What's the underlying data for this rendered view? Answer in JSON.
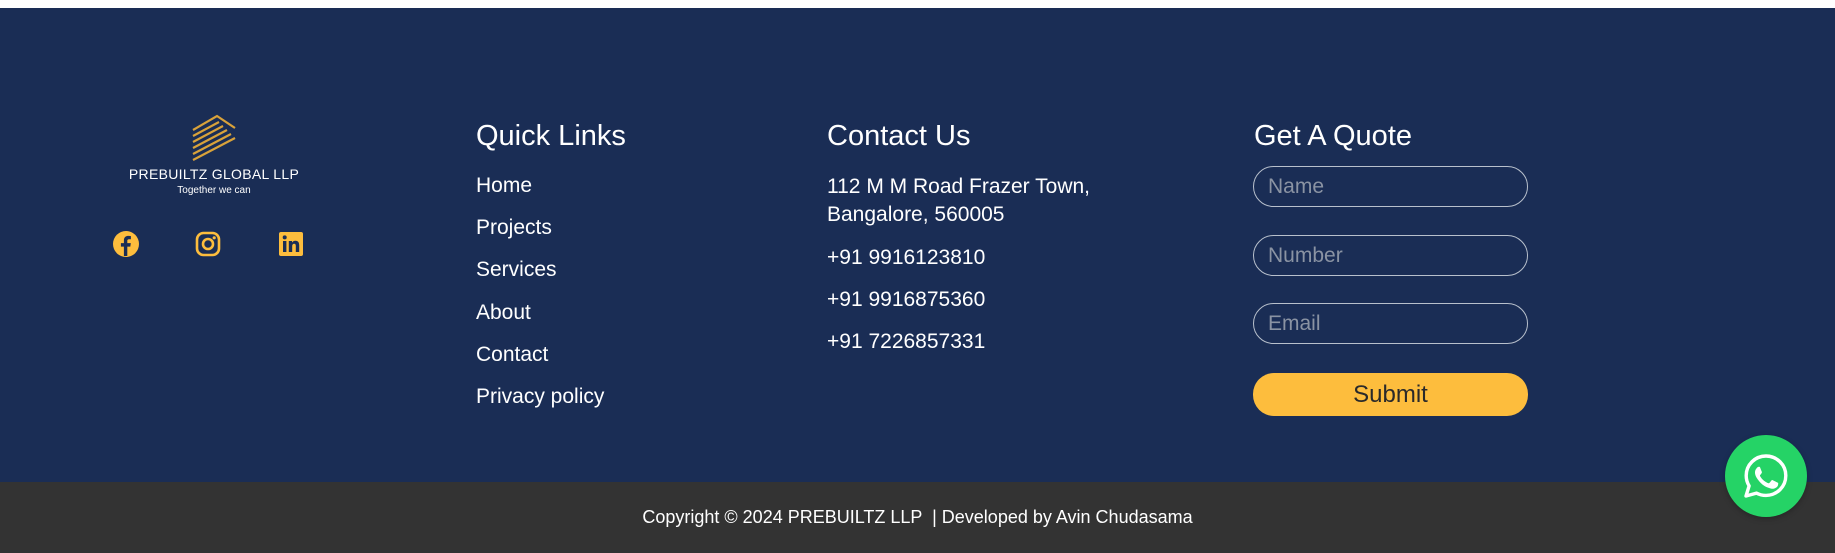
{
  "colors": {
    "footer_bg": "#1a2d55",
    "bottom_bar_bg": "#333333",
    "accent": "#fdbd3d",
    "whatsapp": "#25d366"
  },
  "brand": {
    "name": "PREBUILTZ GLOBAL LLP",
    "tagline": "Together we can",
    "social": [
      "facebook-icon",
      "instagram-icon",
      "linkedin-icon"
    ]
  },
  "quick_links": {
    "title": "Quick Links",
    "items": [
      "Home",
      "Projects",
      "Services",
      "About",
      "Contact",
      "Privacy policy"
    ]
  },
  "contact": {
    "title": "Contact Us",
    "address_line1": "112 M M Road Frazer Town,",
    "address_line2": "Bangalore, 560005",
    "phones": [
      "+91 9916123810",
      "+91 9916875360",
      "+91 7226857331"
    ]
  },
  "quote": {
    "title": "Get A Quote",
    "name_placeholder": "Name",
    "number_placeholder": "Number",
    "email_placeholder": "Email",
    "submit_label": "Submit"
  },
  "copyright": "Copyright © 2024 PREBUILTZ LLP  | Developed by Avin Chudasama"
}
